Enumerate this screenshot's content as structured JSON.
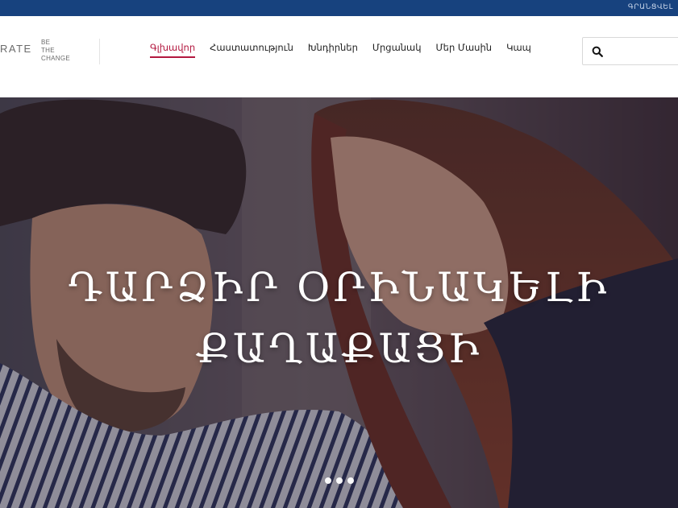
{
  "topbar": {
    "register_label": "ԳՐԱՆՑՎԵԼ"
  },
  "header": {
    "logo_text": "RATE",
    "tagline": [
      "BE",
      "THE",
      "CHANGE"
    ]
  },
  "nav": {
    "items": [
      {
        "label": "Գլխավոր",
        "active": true
      },
      {
        "label": "Հաստատություն",
        "active": false
      },
      {
        "label": "Խնդիրներ",
        "active": false
      },
      {
        "label": "Մրցանակ",
        "active": false
      },
      {
        "label": "Մեր Մասին",
        "active": false
      },
      {
        "label": "Կապ",
        "active": false
      }
    ]
  },
  "search": {
    "placeholder": "",
    "value": ""
  },
  "hero": {
    "title_line1": "ԴԱՐՁԻՐ ՕՐԻՆԱԿԵԼԻ",
    "title_line2": "ՔԱՂԱՔԱՑԻ",
    "slide_count": 3
  },
  "colors": {
    "topbar": "#17427e",
    "accent": "#b3183f",
    "hero_overlay": "#2a2030"
  },
  "icons": {
    "search": "search-icon"
  }
}
